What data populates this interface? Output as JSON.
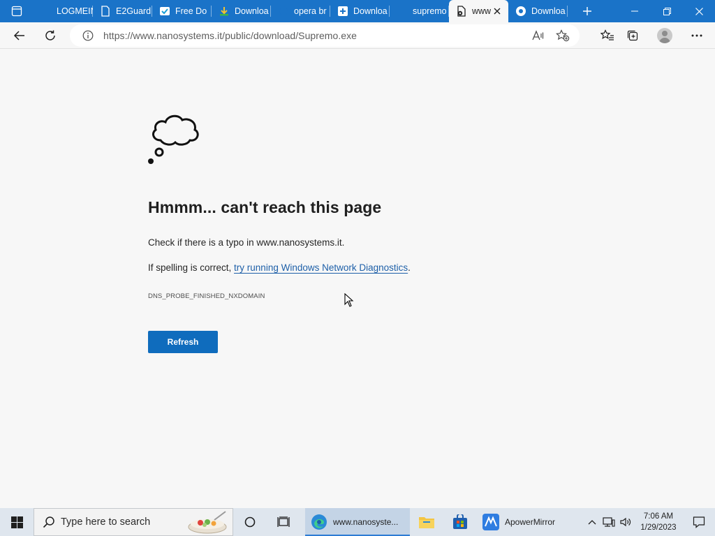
{
  "tabs": [
    {
      "title": "LOGMEIN",
      "icon": "logmein-icon"
    },
    {
      "title": "E2Guard",
      "icon": "document-icon"
    },
    {
      "title": "Free Do",
      "icon": "download-site-icon"
    },
    {
      "title": "Downloa",
      "icon": "download-arrow-icon"
    },
    {
      "title": "opera br",
      "icon": "opera-icon"
    },
    {
      "title": "Downloa",
      "icon": "plus-square-icon"
    },
    {
      "title": "supremo",
      "icon": "supremo-icon"
    },
    {
      "title": "www",
      "icon": "error-document-icon",
      "active": true
    },
    {
      "title": "Downloa",
      "icon": "edge-icon"
    }
  ],
  "address_bar": {
    "url": "https://www.nanosystems.it/public/download/Supremo.exe"
  },
  "error_page": {
    "title": "Hmmm... can't reach this page",
    "line1": "Check if there is a typo in www.nanosystems.it.",
    "line2_prefix": "If spelling is correct, ",
    "line2_link": "try running Windows Network Diagnostics",
    "line2_suffix": ".",
    "error_code": "DNS_PROBE_FINISHED_NXDOMAIN",
    "refresh_label": "Refresh"
  },
  "taskbar": {
    "search_placeholder": "Type here to search",
    "edge_app_label": "www.nanosyste...",
    "apowermirror_label": "ApowerMirror",
    "time": "7:06 AM",
    "date": "1/29/2023"
  },
  "colors": {
    "tab_bar": "#1a73c8",
    "accent_button": "#0f6cbd",
    "link": "#1d5fa8",
    "page_background": "#f7f7f7"
  }
}
